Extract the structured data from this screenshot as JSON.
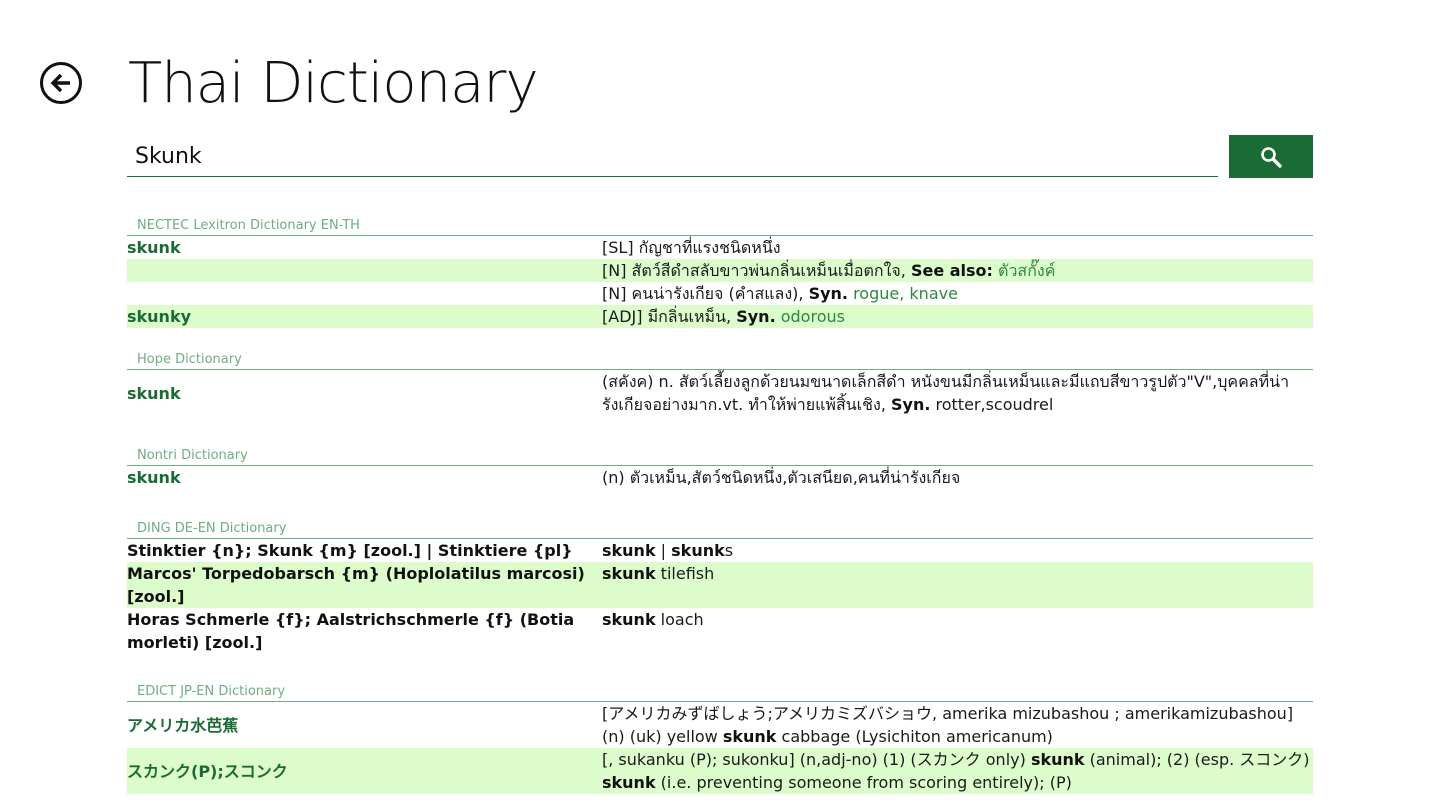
{
  "header": {
    "title": "Thai Dictionary",
    "back_icon": "back-arrow-icon"
  },
  "search": {
    "value": "Skunk",
    "button_icon": "search-icon"
  },
  "colors": {
    "accent": "#1b6b35",
    "row_highlight": "#dcfccc",
    "section_title": "#6fae7f"
  },
  "sections": [
    {
      "title": "NECTEC Lexitron Dictionary EN-TH",
      "rows": [
        {
          "word": "skunk",
          "pos": "[SL]",
          "text": "กัญชาที่แรงชนิดหนึ่ง"
        },
        {
          "word": "",
          "pos": "[N]",
          "text": "สัตว์สีดำสลับขาวพ่นกลิ่นเหม็นเมื่อตกใจ,",
          "label": "See also:",
          "link": "ตัวสกั๊งค์"
        },
        {
          "word": "",
          "pos": "[N]",
          "text": "คนน่ารังเกียจ (คำสแลง),",
          "label": "Syn.",
          "link": "rogue, knave"
        },
        {
          "word": "skunky",
          "pos": "[ADJ]",
          "text": "มีกลิ่นเหม็น,",
          "label": "Syn.",
          "link": "odorous"
        }
      ]
    },
    {
      "title": "Hope Dictionary",
      "rows": [
        {
          "word": "skunk",
          "text": "(สคังค) n. สัตว์เลี้ยงลูกด้วยนมขนาดเล็กสีดำ หนังขนมีกลิ่นเหม็นและมีแถบสีขาวรูปตัว\"V\",บุคคลที่น่ารังเกียจอย่างมาก.vt. ทำให้พ่ายแพ้สิ้นเชิง,",
          "label": "Syn.",
          "tail": "rotter,scoudrel"
        }
      ]
    },
    {
      "title": "Nontri Dictionary",
      "rows": [
        {
          "word": "skunk",
          "text": "(n) ตัวเหม็น,สัตว์ชนิดหนึ่ง,ตัวเสนียด,คนที่น่ารังเกียจ"
        }
      ]
    },
    {
      "title": "DING DE-EN Dictionary",
      "rows": [
        {
          "word": "Stinktier {n}; Skunk {m} [zool.] | Stinktiere {pl}",
          "kw1": "skunk",
          "sep": " | ",
          "kw2": "skunk",
          "suffix": "s"
        },
        {
          "word": "Marcos' Torpedobarsch {m} (Hoplolatilus marcosi) [zool.]",
          "kw1": "skunk",
          "rest": " tilefish"
        },
        {
          "word": "Horas Schmerle {f}; Aalstrichschmerle {f} (Botia morleti) [zool.]",
          "kw1": "skunk",
          "rest": " loach"
        }
      ]
    },
    {
      "title": "EDICT JP-EN Dictionary",
      "rows": [
        {
          "word": "アメリカ水芭蕉",
          "pre": "[アメリカみずばしょう;アメリカミズバショウ, amerika mizubashou ; amerikamizubashou] (n) (uk) yellow ",
          "kw": "skunk",
          "post": " cabbage (Lysichiton americanum)"
        },
        {
          "word": "スカンク(P);スコンク",
          "pre": "[, sukanku (P); sukonku] (n,adj-no) (1) (スカンク only) ",
          "kw": "skunk",
          "mid": " (animal); (2) (esp. スコンク) ",
          "kw2": "skunk",
          "post": " (i.e. preventing someone from scoring entirely); (P)"
        }
      ]
    }
  ]
}
